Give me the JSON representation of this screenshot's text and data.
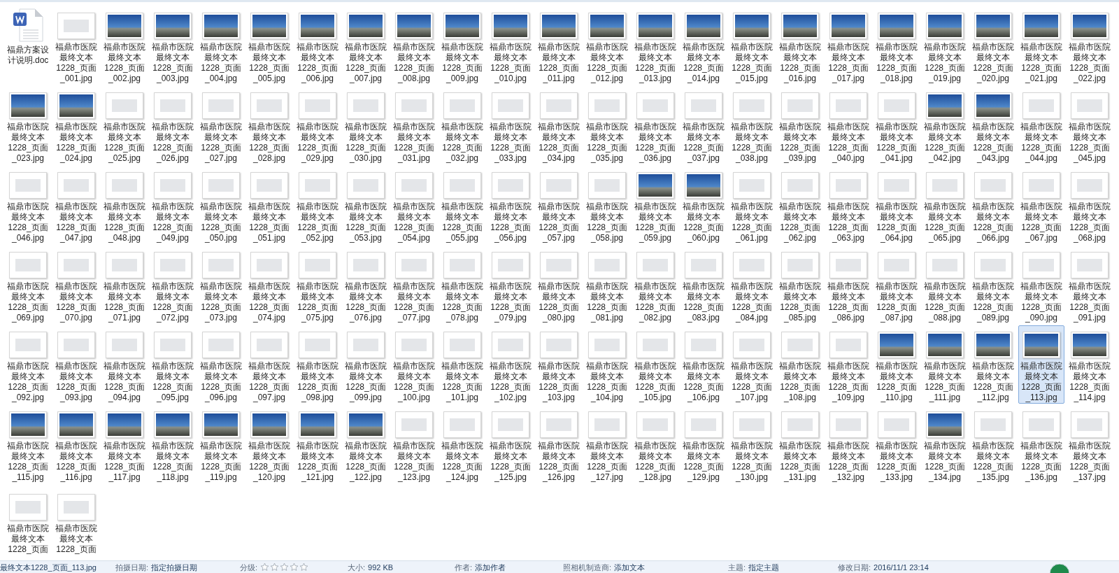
{
  "items": [
    {
      "name_lines": [
        "福鼎方案设",
        "计说明.doc"
      ],
      "kind": "doc",
      "selected": false
    },
    {
      "name_lines": [
        "福鼎市医院",
        "最终文本",
        "1228_页面",
        "_001.jpg"
      ],
      "kind": "sheet",
      "selected": false
    },
    {
      "name_lines": [
        "福鼎市医院",
        "最终文本",
        "1228_页面",
        "_002.jpg"
      ],
      "kind": "render",
      "selected": false
    },
    {
      "name_lines": [
        "福鼎市医院",
        "最终文本",
        "1228_页面",
        "_003.jpg"
      ],
      "kind": "render",
      "selected": false
    },
    {
      "name_lines": [
        "福鼎市医院",
        "最终文本",
        "1228_页面",
        "_004.jpg"
      ],
      "kind": "render",
      "selected": false
    },
    {
      "name_lines": [
        "福鼎市医院",
        "最终文本",
        "1228_页面",
        "_005.jpg"
      ],
      "kind": "render",
      "selected": false
    },
    {
      "name_lines": [
        "福鼎市医院",
        "最终文本",
        "1228_页面",
        "_006.jpg"
      ],
      "kind": "render",
      "selected": false
    },
    {
      "name_lines": [
        "福鼎市医院",
        "最终文本",
        "1228_页面",
        "_007.jpg"
      ],
      "kind": "render",
      "selected": false
    },
    {
      "name_lines": [
        "福鼎市医院",
        "最终文本",
        "1228_页面",
        "_008.jpg"
      ],
      "kind": "render",
      "selected": false
    },
    {
      "name_lines": [
        "福鼎市医院",
        "最终文本",
        "1228_页面",
        "_009.jpg"
      ],
      "kind": "render",
      "selected": false
    },
    {
      "name_lines": [
        "福鼎市医院",
        "最终文本",
        "1228_页面",
        "_010.jpg"
      ],
      "kind": "render",
      "selected": false
    },
    {
      "name_lines": [
        "福鼎市医院",
        "最终文本",
        "1228_页面",
        "_011.jpg"
      ],
      "kind": "render",
      "selected": false
    },
    {
      "name_lines": [
        "福鼎市医院",
        "最终文本",
        "1228_页面",
        "_012.jpg"
      ],
      "kind": "render",
      "selected": false
    },
    {
      "name_lines": [
        "福鼎市医院",
        "最终文本",
        "1228_页面",
        "_013.jpg"
      ],
      "kind": "render",
      "selected": false
    },
    {
      "name_lines": [
        "福鼎市医院",
        "最终文本",
        "1228_页面",
        "_014.jpg"
      ],
      "kind": "render",
      "selected": false
    },
    {
      "name_lines": [
        "福鼎市医院",
        "最终文本",
        "1228_页面",
        "_015.jpg"
      ],
      "kind": "render",
      "selected": false
    },
    {
      "name_lines": [
        "福鼎市医院",
        "最终文本",
        "1228_页面",
        "_016.jpg"
      ],
      "kind": "render",
      "selected": false
    },
    {
      "name_lines": [
        "福鼎市医院",
        "最终文本",
        "1228_页面",
        "_017.jpg"
      ],
      "kind": "render",
      "selected": false
    },
    {
      "name_lines": [
        "福鼎市医院",
        "最终文本",
        "1228_页面",
        "_018.jpg"
      ],
      "kind": "render",
      "selected": false
    },
    {
      "name_lines": [
        "福鼎市医院",
        "最终文本",
        "1228_页面",
        "_019.jpg"
      ],
      "kind": "render",
      "selected": false
    },
    {
      "name_lines": [
        "福鼎市医院",
        "最终文本",
        "1228_页面",
        "_020.jpg"
      ],
      "kind": "render",
      "selected": false
    },
    {
      "name_lines": [
        "福鼎市医院",
        "最终文本",
        "1228_页面",
        "_021.jpg"
      ],
      "kind": "render",
      "selected": false
    },
    {
      "name_lines": [
        "福鼎市医院",
        "最终文本",
        "1228_页面",
        "_022.jpg"
      ],
      "kind": "render",
      "selected": false
    },
    {
      "name_lines": [
        "福鼎市医院",
        "最终文本",
        "1228_页面",
        "_023.jpg"
      ],
      "kind": "render",
      "selected": false
    },
    {
      "name_lines": [
        "福鼎市医院",
        "最终文本",
        "1228_页面",
        "_024.jpg"
      ],
      "kind": "render",
      "selected": false
    },
    {
      "name_lines": [
        "福鼎市医院",
        "最终文本",
        "1228_页面",
        "_025.jpg"
      ],
      "kind": "sheet",
      "selected": false
    },
    {
      "name_lines": [
        "福鼎市医院",
        "最终文本",
        "1228_页面",
        "_026.jpg"
      ],
      "kind": "sheet",
      "selected": false
    },
    {
      "name_lines": [
        "福鼎市医院",
        "最终文本",
        "1228_页面",
        "_027.jpg"
      ],
      "kind": "sheet",
      "selected": false
    },
    {
      "name_lines": [
        "福鼎市医院",
        "最终文本",
        "1228_页面",
        "_028.jpg"
      ],
      "kind": "sheet",
      "selected": false
    },
    {
      "name_lines": [
        "福鼎市医院",
        "最终文本",
        "1228_页面",
        "_029.jpg"
      ],
      "kind": "sheet",
      "selected": false
    },
    {
      "name_lines": [
        "福鼎市医院",
        "最终文本",
        "1228_页面",
        "_030.jpg"
      ],
      "kind": "sheet",
      "selected": false
    },
    {
      "name_lines": [
        "福鼎市医院",
        "最终文本",
        "1228_页面",
        "_031.jpg"
      ],
      "kind": "sheet",
      "selected": false
    },
    {
      "name_lines": [
        "福鼎市医院",
        "最终文本",
        "1228_页面",
        "_032.jpg"
      ],
      "kind": "sheet",
      "selected": false
    },
    {
      "name_lines": [
        "福鼎市医院",
        "最终文本",
        "1228_页面",
        "_033.jpg"
      ],
      "kind": "sheet",
      "selected": false
    },
    {
      "name_lines": [
        "福鼎市医院",
        "最终文本",
        "1228_页面",
        "_034.jpg"
      ],
      "kind": "sheet",
      "selected": false
    },
    {
      "name_lines": [
        "福鼎市医院",
        "最终文本",
        "1228_页面",
        "_035.jpg"
      ],
      "kind": "sheet",
      "selected": false
    },
    {
      "name_lines": [
        "福鼎市医院",
        "最终文本",
        "1228_页面",
        "_036.jpg"
      ],
      "kind": "sheet",
      "selected": false
    },
    {
      "name_lines": [
        "福鼎市医院",
        "最终文本",
        "1228_页面",
        "_037.jpg"
      ],
      "kind": "sheet",
      "selected": false
    },
    {
      "name_lines": [
        "福鼎市医院",
        "最终文本",
        "1228_页面",
        "_038.jpg"
      ],
      "kind": "sheet",
      "selected": false
    },
    {
      "name_lines": [
        "福鼎市医院",
        "最终文本",
        "1228_页面",
        "_039.jpg"
      ],
      "kind": "sheet",
      "selected": false
    },
    {
      "name_lines": [
        "福鼎市医院",
        "最终文本",
        "1228_页面",
        "_040.jpg"
      ],
      "kind": "sheet",
      "selected": false
    },
    {
      "name_lines": [
        "福鼎市医院",
        "最终文本",
        "1228_页面",
        "_041.jpg"
      ],
      "kind": "sheet",
      "selected": false
    },
    {
      "name_lines": [
        "福鼎市医院",
        "最终文本",
        "1228_页面",
        "_042.jpg"
      ],
      "kind": "render",
      "selected": false
    },
    {
      "name_lines": [
        "福鼎市医院",
        "最终文本",
        "1228_页面",
        "_043.jpg"
      ],
      "kind": "render",
      "selected": false
    },
    {
      "name_lines": [
        "福鼎市医院",
        "最终文本",
        "1228_页面",
        "_044.jpg"
      ],
      "kind": "sheet",
      "selected": false
    },
    {
      "name_lines": [
        "福鼎市医院",
        "最终文本",
        "1228_页面",
        "_045.jpg"
      ],
      "kind": "sheet",
      "selected": false
    },
    {
      "name_lines": [
        "福鼎市医院",
        "最终文本",
        "1228_页面",
        "_046.jpg"
      ],
      "kind": "sheet",
      "selected": false
    },
    {
      "name_lines": [
        "福鼎市医院",
        "最终文本",
        "1228_页面",
        "_047.jpg"
      ],
      "kind": "sheet",
      "selected": false
    },
    {
      "name_lines": [
        "福鼎市医院",
        "最终文本",
        "1228_页面",
        "_048.jpg"
      ],
      "kind": "sheet",
      "selected": false
    },
    {
      "name_lines": [
        "福鼎市医院",
        "最终文本",
        "1228_页面",
        "_049.jpg"
      ],
      "kind": "sheet",
      "selected": false
    },
    {
      "name_lines": [
        "福鼎市医院",
        "最终文本",
        "1228_页面",
        "_050.jpg"
      ],
      "kind": "sheet",
      "selected": false
    },
    {
      "name_lines": [
        "福鼎市医院",
        "最终文本",
        "1228_页面",
        "_051.jpg"
      ],
      "kind": "sheet",
      "selected": false
    },
    {
      "name_lines": [
        "福鼎市医院",
        "最终文本",
        "1228_页面",
        "_052.jpg"
      ],
      "kind": "sheet",
      "selected": false
    },
    {
      "name_lines": [
        "福鼎市医院",
        "最终文本",
        "1228_页面",
        "_053.jpg"
      ],
      "kind": "sheet",
      "selected": false
    },
    {
      "name_lines": [
        "福鼎市医院",
        "最终文本",
        "1228_页面",
        "_054.jpg"
      ],
      "kind": "sheet",
      "selected": false
    },
    {
      "name_lines": [
        "福鼎市医院",
        "最终文本",
        "1228_页面",
        "_055.jpg"
      ],
      "kind": "sheet",
      "selected": false
    },
    {
      "name_lines": [
        "福鼎市医院",
        "最终文本",
        "1228_页面",
        "_056.jpg"
      ],
      "kind": "sheet",
      "selected": false
    },
    {
      "name_lines": [
        "福鼎市医院",
        "最终文本",
        "1228_页面",
        "_057.jpg"
      ],
      "kind": "sheet",
      "selected": false
    },
    {
      "name_lines": [
        "福鼎市医院",
        "最终文本",
        "1228_页面",
        "_058.jpg"
      ],
      "kind": "sheet",
      "selected": false
    },
    {
      "name_lines": [
        "福鼎市医院",
        "最终文本",
        "1228_页面",
        "_059.jpg"
      ],
      "kind": "render",
      "selected": false
    },
    {
      "name_lines": [
        "福鼎市医院",
        "最终文本",
        "1228_页面",
        "_060.jpg"
      ],
      "kind": "render",
      "selected": false
    },
    {
      "name_lines": [
        "福鼎市医院",
        "最终文本",
        "1228_页面",
        "_061.jpg"
      ],
      "kind": "sheet",
      "selected": false
    },
    {
      "name_lines": [
        "福鼎市医院",
        "最终文本",
        "1228_页面",
        "_062.jpg"
      ],
      "kind": "sheet",
      "selected": false
    },
    {
      "name_lines": [
        "福鼎市医院",
        "最终文本",
        "1228_页面",
        "_063.jpg"
      ],
      "kind": "sheet",
      "selected": false
    },
    {
      "name_lines": [
        "福鼎市医院",
        "最终文本",
        "1228_页面",
        "_064.jpg"
      ],
      "kind": "sheet",
      "selected": false
    },
    {
      "name_lines": [
        "福鼎市医院",
        "最终文本",
        "1228_页面",
        "_065.jpg"
      ],
      "kind": "sheet",
      "selected": false
    },
    {
      "name_lines": [
        "福鼎市医院",
        "最终文本",
        "1228_页面",
        "_066.jpg"
      ],
      "kind": "sheet",
      "selected": false
    },
    {
      "name_lines": [
        "福鼎市医院",
        "最终文本",
        "1228_页面",
        "_067.jpg"
      ],
      "kind": "sheet",
      "selected": false
    },
    {
      "name_lines": [
        "福鼎市医院",
        "最终文本",
        "1228_页面",
        "_068.jpg"
      ],
      "kind": "sheet",
      "selected": false
    },
    {
      "name_lines": [
        "福鼎市医院",
        "最终文本",
        "1228_页面",
        "_069.jpg"
      ],
      "kind": "sheet",
      "selected": false
    },
    {
      "name_lines": [
        "福鼎市医院",
        "最终文本",
        "1228_页面",
        "_070.jpg"
      ],
      "kind": "sheet",
      "selected": false
    },
    {
      "name_lines": [
        "福鼎市医院",
        "最终文本",
        "1228_页面",
        "_071.jpg"
      ],
      "kind": "sheet",
      "selected": false
    },
    {
      "name_lines": [
        "福鼎市医院",
        "最终文本",
        "1228_页面",
        "_072.jpg"
      ],
      "kind": "sheet",
      "selected": false
    },
    {
      "name_lines": [
        "福鼎市医院",
        "最终文本",
        "1228_页面",
        "_073.jpg"
      ],
      "kind": "sheet",
      "selected": false
    },
    {
      "name_lines": [
        "福鼎市医院",
        "最终文本",
        "1228_页面",
        "_074.jpg"
      ],
      "kind": "sheet",
      "selected": false
    },
    {
      "name_lines": [
        "福鼎市医院",
        "最终文本",
        "1228_页面",
        "_075.jpg"
      ],
      "kind": "sheet",
      "selected": false
    },
    {
      "name_lines": [
        "福鼎市医院",
        "最终文本",
        "1228_页面",
        "_076.jpg"
      ],
      "kind": "sheet",
      "selected": false
    },
    {
      "name_lines": [
        "福鼎市医院",
        "最终文本",
        "1228_页面",
        "_077.jpg"
      ],
      "kind": "sheet",
      "selected": false
    },
    {
      "name_lines": [
        "福鼎市医院",
        "最终文本",
        "1228_页面",
        "_078.jpg"
      ],
      "kind": "sheet",
      "selected": false
    },
    {
      "name_lines": [
        "福鼎市医院",
        "最终文本",
        "1228_页面",
        "_079.jpg"
      ],
      "kind": "sheet",
      "selected": false
    },
    {
      "name_lines": [
        "福鼎市医院",
        "最终文本",
        "1228_页面",
        "_080.jpg"
      ],
      "kind": "sheet",
      "selected": false
    },
    {
      "name_lines": [
        "福鼎市医院",
        "最终文本",
        "1228_页面",
        "_081.jpg"
      ],
      "kind": "sheet",
      "selected": false
    },
    {
      "name_lines": [
        "福鼎市医院",
        "最终文本",
        "1228_页面",
        "_082.jpg"
      ],
      "kind": "sheet",
      "selected": false
    },
    {
      "name_lines": [
        "福鼎市医院",
        "最终文本",
        "1228_页面",
        "_083.jpg"
      ],
      "kind": "sheet",
      "selected": false
    },
    {
      "name_lines": [
        "福鼎市医院",
        "最终文本",
        "1228_页面",
        "_084.jpg"
      ],
      "kind": "sheet",
      "selected": false
    },
    {
      "name_lines": [
        "福鼎市医院",
        "最终文本",
        "1228_页面",
        "_085.jpg"
      ],
      "kind": "sheet",
      "selected": false
    },
    {
      "name_lines": [
        "福鼎市医院",
        "最终文本",
        "1228_页面",
        "_086.jpg"
      ],
      "kind": "sheet",
      "selected": false
    },
    {
      "name_lines": [
        "福鼎市医院",
        "最终文本",
        "1228_页面",
        "_087.jpg"
      ],
      "kind": "sheet",
      "selected": false
    },
    {
      "name_lines": [
        "福鼎市医院",
        "最终文本",
        "1228_页面",
        "_088.jpg"
      ],
      "kind": "sheet",
      "selected": false
    },
    {
      "name_lines": [
        "福鼎市医院",
        "最终文本",
        "1228_页面",
        "_089.jpg"
      ],
      "kind": "sheet",
      "selected": false
    },
    {
      "name_lines": [
        "福鼎市医院",
        "最终文本",
        "1228_页面",
        "_090.jpg"
      ],
      "kind": "sheet",
      "selected": false
    },
    {
      "name_lines": [
        "福鼎市医院",
        "最终文本",
        "1228_页面",
        "_091.jpg"
      ],
      "kind": "sheet",
      "selected": false
    },
    {
      "name_lines": [
        "福鼎市医院",
        "最终文本",
        "1228_页面",
        "_092.jpg"
      ],
      "kind": "sheet",
      "selected": false
    },
    {
      "name_lines": [
        "福鼎市医院",
        "最终文本",
        "1228_页面",
        "_093.jpg"
      ],
      "kind": "sheet",
      "selected": false
    },
    {
      "name_lines": [
        "福鼎市医院",
        "最终文本",
        "1228_页面",
        "_094.jpg"
      ],
      "kind": "sheet",
      "selected": false
    },
    {
      "name_lines": [
        "福鼎市医院",
        "最终文本",
        "1228_页面",
        "_095.jpg"
      ],
      "kind": "sheet",
      "selected": false
    },
    {
      "name_lines": [
        "福鼎市医院",
        "最终文本",
        "1228_页面",
        "_096.jpg"
      ],
      "kind": "sheet",
      "selected": false
    },
    {
      "name_lines": [
        "福鼎市医院",
        "最终文本",
        "1228_页面",
        "_097.jpg"
      ],
      "kind": "sheet",
      "selected": false
    },
    {
      "name_lines": [
        "福鼎市医院",
        "最终文本",
        "1228_页面",
        "_098.jpg"
      ],
      "kind": "sheet",
      "selected": false
    },
    {
      "name_lines": [
        "福鼎市医院",
        "最终文本",
        "1228_页面",
        "_099.jpg"
      ],
      "kind": "sheet",
      "selected": false
    },
    {
      "name_lines": [
        "福鼎市医院",
        "最终文本",
        "1228_页面",
        "_100.jpg"
      ],
      "kind": "sheet",
      "selected": false
    },
    {
      "name_lines": [
        "福鼎市医院",
        "最终文本",
        "1228_页面",
        "_101.jpg"
      ],
      "kind": "sheet",
      "selected": false
    },
    {
      "name_lines": [
        "福鼎市医院",
        "最终文本",
        "1228_页面",
        "_102.jpg"
      ],
      "kind": "sheet",
      "selected": false
    },
    {
      "name_lines": [
        "福鼎市医院",
        "最终文本",
        "1228_页面",
        "_103.jpg"
      ],
      "kind": "sheet",
      "selected": false
    },
    {
      "name_lines": [
        "福鼎市医院",
        "最终文本",
        "1228_页面",
        "_104.jpg"
      ],
      "kind": "sheet",
      "selected": false
    },
    {
      "name_lines": [
        "福鼎市医院",
        "最终文本",
        "1228_页面",
        "_105.jpg"
      ],
      "kind": "sheet",
      "selected": false
    },
    {
      "name_lines": [
        "福鼎市医院",
        "最终文本",
        "1228_页面",
        "_106.jpg"
      ],
      "kind": "sheet",
      "selected": false
    },
    {
      "name_lines": [
        "福鼎市医院",
        "最终文本",
        "1228_页面",
        "_107.jpg"
      ],
      "kind": "sheet",
      "selected": false
    },
    {
      "name_lines": [
        "福鼎市医院",
        "最终文本",
        "1228_页面",
        "_108.jpg"
      ],
      "kind": "sheet",
      "selected": false
    },
    {
      "name_lines": [
        "福鼎市医院",
        "最终文本",
        "1228_页面",
        "_109.jpg"
      ],
      "kind": "sheet",
      "selected": false
    },
    {
      "name_lines": [
        "福鼎市医院",
        "最终文本",
        "1228_页面",
        "_110.jpg"
      ],
      "kind": "render",
      "selected": false
    },
    {
      "name_lines": [
        "福鼎市医院",
        "最终文本",
        "1228_页面",
        "_111.jpg"
      ],
      "kind": "render",
      "selected": false
    },
    {
      "name_lines": [
        "福鼎市医院",
        "最终文本",
        "1228_页面",
        "_112.jpg"
      ],
      "kind": "render",
      "selected": false
    },
    {
      "name_lines": [
        "福鼎市医院",
        "最终文本",
        "1228_页面",
        "_113.jpg"
      ],
      "kind": "render",
      "selected": true
    },
    {
      "name_lines": [
        "福鼎市医院",
        "最终文本",
        "1228_页面",
        "_114.jpg"
      ],
      "kind": "render",
      "selected": false
    },
    {
      "name_lines": [
        "福鼎市医院",
        "最终文本",
        "1228_页面",
        "_115.jpg"
      ],
      "kind": "render",
      "selected": false
    },
    {
      "name_lines": [
        "福鼎市医院",
        "最终文本",
        "1228_页面",
        "_116.jpg"
      ],
      "kind": "render",
      "selected": false
    },
    {
      "name_lines": [
        "福鼎市医院",
        "最终文本",
        "1228_页面",
        "_117.jpg"
      ],
      "kind": "render",
      "selected": false
    },
    {
      "name_lines": [
        "福鼎市医院",
        "最终文本",
        "1228_页面",
        "_118.jpg"
      ],
      "kind": "render",
      "selected": false
    },
    {
      "name_lines": [
        "福鼎市医院",
        "最终文本",
        "1228_页面",
        "_119.jpg"
      ],
      "kind": "render",
      "selected": false
    },
    {
      "name_lines": [
        "福鼎市医院",
        "最终文本",
        "1228_页面",
        "_120.jpg"
      ],
      "kind": "render",
      "selected": false
    },
    {
      "name_lines": [
        "福鼎市医院",
        "最终文本",
        "1228_页面",
        "_121.jpg"
      ],
      "kind": "render",
      "selected": false
    },
    {
      "name_lines": [
        "福鼎市医院",
        "最终文本",
        "1228_页面",
        "_122.jpg"
      ],
      "kind": "render",
      "selected": false
    },
    {
      "name_lines": [
        "福鼎市医院",
        "最终文本",
        "1228_页面",
        "_123.jpg"
      ],
      "kind": "sheet",
      "selected": false
    },
    {
      "name_lines": [
        "福鼎市医院",
        "最终文本",
        "1228_页面",
        "_124.jpg"
      ],
      "kind": "sheet",
      "selected": false
    },
    {
      "name_lines": [
        "福鼎市医院",
        "最终文本",
        "1228_页面",
        "_125.jpg"
      ],
      "kind": "sheet",
      "selected": false
    },
    {
      "name_lines": [
        "福鼎市医院",
        "最终文本",
        "1228_页面",
        "_126.jpg"
      ],
      "kind": "sheet",
      "selected": false
    },
    {
      "name_lines": [
        "福鼎市医院",
        "最终文本",
        "1228_页面",
        "_127.jpg"
      ],
      "kind": "sheet",
      "selected": false
    },
    {
      "name_lines": [
        "福鼎市医院",
        "最终文本",
        "1228_页面",
        "_128.jpg"
      ],
      "kind": "sheet",
      "selected": false
    },
    {
      "name_lines": [
        "福鼎市医院",
        "最终文本",
        "1228_页面",
        "_129.jpg"
      ],
      "kind": "sheet",
      "selected": false
    },
    {
      "name_lines": [
        "福鼎市医院",
        "最终文本",
        "1228_页面",
        "_130.jpg"
      ],
      "kind": "sheet",
      "selected": false
    },
    {
      "name_lines": [
        "福鼎市医院",
        "最终文本",
        "1228_页面",
        "_131.jpg"
      ],
      "kind": "sheet",
      "selected": false
    },
    {
      "name_lines": [
        "福鼎市医院",
        "最终文本",
        "1228_页面",
        "_132.jpg"
      ],
      "kind": "sheet",
      "selected": false
    },
    {
      "name_lines": [
        "福鼎市医院",
        "最终文本",
        "1228_页面",
        "_133.jpg"
      ],
      "kind": "sheet",
      "selected": false
    },
    {
      "name_lines": [
        "福鼎市医院",
        "最终文本",
        "1228_页面",
        "_134.jpg"
      ],
      "kind": "render",
      "selected": false
    },
    {
      "name_lines": [
        "福鼎市医院",
        "最终文本",
        "1228_页面",
        "_135.jpg"
      ],
      "kind": "sheet",
      "selected": false
    },
    {
      "name_lines": [
        "福鼎市医院",
        "最终文本",
        "1228_页面",
        "_136.jpg"
      ],
      "kind": "sheet",
      "selected": false
    },
    {
      "name_lines": [
        "福鼎市医院",
        "最终文本",
        "1228_页面",
        "_137.jpg"
      ],
      "kind": "sheet",
      "selected": false
    },
    {
      "name_lines": [
        "福鼎市医院",
        "最终文本",
        "1228_页面"
      ],
      "kind": "sheet",
      "selected": false
    },
    {
      "name_lines": [
        "福鼎市医院",
        "最终文本",
        "1228_页面"
      ],
      "kind": "sheet",
      "selected": false
    }
  ],
  "status_bar": {
    "file_name": "最终文本1228_页面_113.jpg",
    "fields": [
      {
        "kind": "text",
        "label": "拍摄日期:",
        "value": "指定拍摄日期"
      },
      {
        "kind": "rating",
        "label": "分级:",
        "stars": 0
      },
      {
        "kind": "text",
        "label": "大小:",
        "value": "992 KB"
      },
      {
        "kind": "text",
        "label": "作者:",
        "value": "添加作者"
      },
      {
        "kind": "text",
        "label": "照相机制造商:",
        "value": "添加文本"
      },
      {
        "kind": "text",
        "label": "主题:",
        "value": "指定主题"
      },
      {
        "kind": "text",
        "label": "修改日期:",
        "value": "2016/11/1 23:14"
      }
    ]
  }
}
